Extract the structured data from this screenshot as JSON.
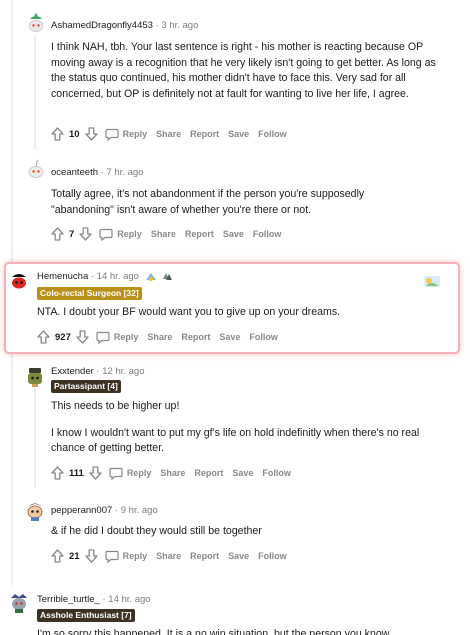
{
  "comments": [
    {
      "author": "AshamedDragonfly4453",
      "time": "3 hr. ago",
      "paragraphs": [
        "I think NAH, tbh. Your last sentence is right - his mother is reacting because OP moving away is a recognition that he very likely isn't going to get better. As long as the status quo continued, his mother didn't have to face this. Very sad for all concerned, but OP is definitely not at fault for wanting to live her life, I agree."
      ],
      "votes": "10"
    },
    {
      "author": "oceanteeth",
      "time": "7 hr. ago",
      "paragraphs": [
        "Totally agree, it's not abandonment if the person you're supposedly \"abandoning\" isn't aware of whether you're there or not."
      ],
      "votes": "7"
    },
    {
      "author": "Hemenucha",
      "time": "14 hr. ago",
      "flair": "Colo-rectal Surgeon [32]",
      "paragraphs": [
        "NTA. I doubt your BF would want you to give up on your dreams."
      ],
      "votes": "927"
    },
    {
      "author": "Exxtender",
      "time": "12 hr. ago",
      "flair": "Partassipant [4]",
      "paragraphs": [
        "This needs to be higher up!",
        "I know I wouldn't want to put my gf's life on hold indefinitly when there's no real chance of getting better."
      ],
      "votes": "111"
    },
    {
      "author": "pepperann007",
      "time": "9 hr. ago",
      "paragraphs": [
        "& if he did I doubt they would still be together"
      ],
      "votes": "21"
    },
    {
      "author": "Terrible_turtle_",
      "time": "14 hr. ago",
      "flair": "Asshole Enthusiast [7]",
      "paragraphs": [
        "I'm so sorry this happened. It is a no win situation, but the person you know"
      ]
    }
  ],
  "ui": {
    "separator": "·",
    "reply": "Reply",
    "share": "Share",
    "report": "Report",
    "save": "Save",
    "follow": "Follow"
  },
  "colors": {
    "highlight_border": "#f7b2b8",
    "flair_gold": "#b8901a",
    "flair_dark": "#3d3222",
    "meta_text": "#7c7c7c",
    "action_text": "#878a8c"
  },
  "icons": [
    "upvote-icon",
    "downvote-icon",
    "reply-icon",
    "award-icon",
    "snoo-avatar"
  ]
}
